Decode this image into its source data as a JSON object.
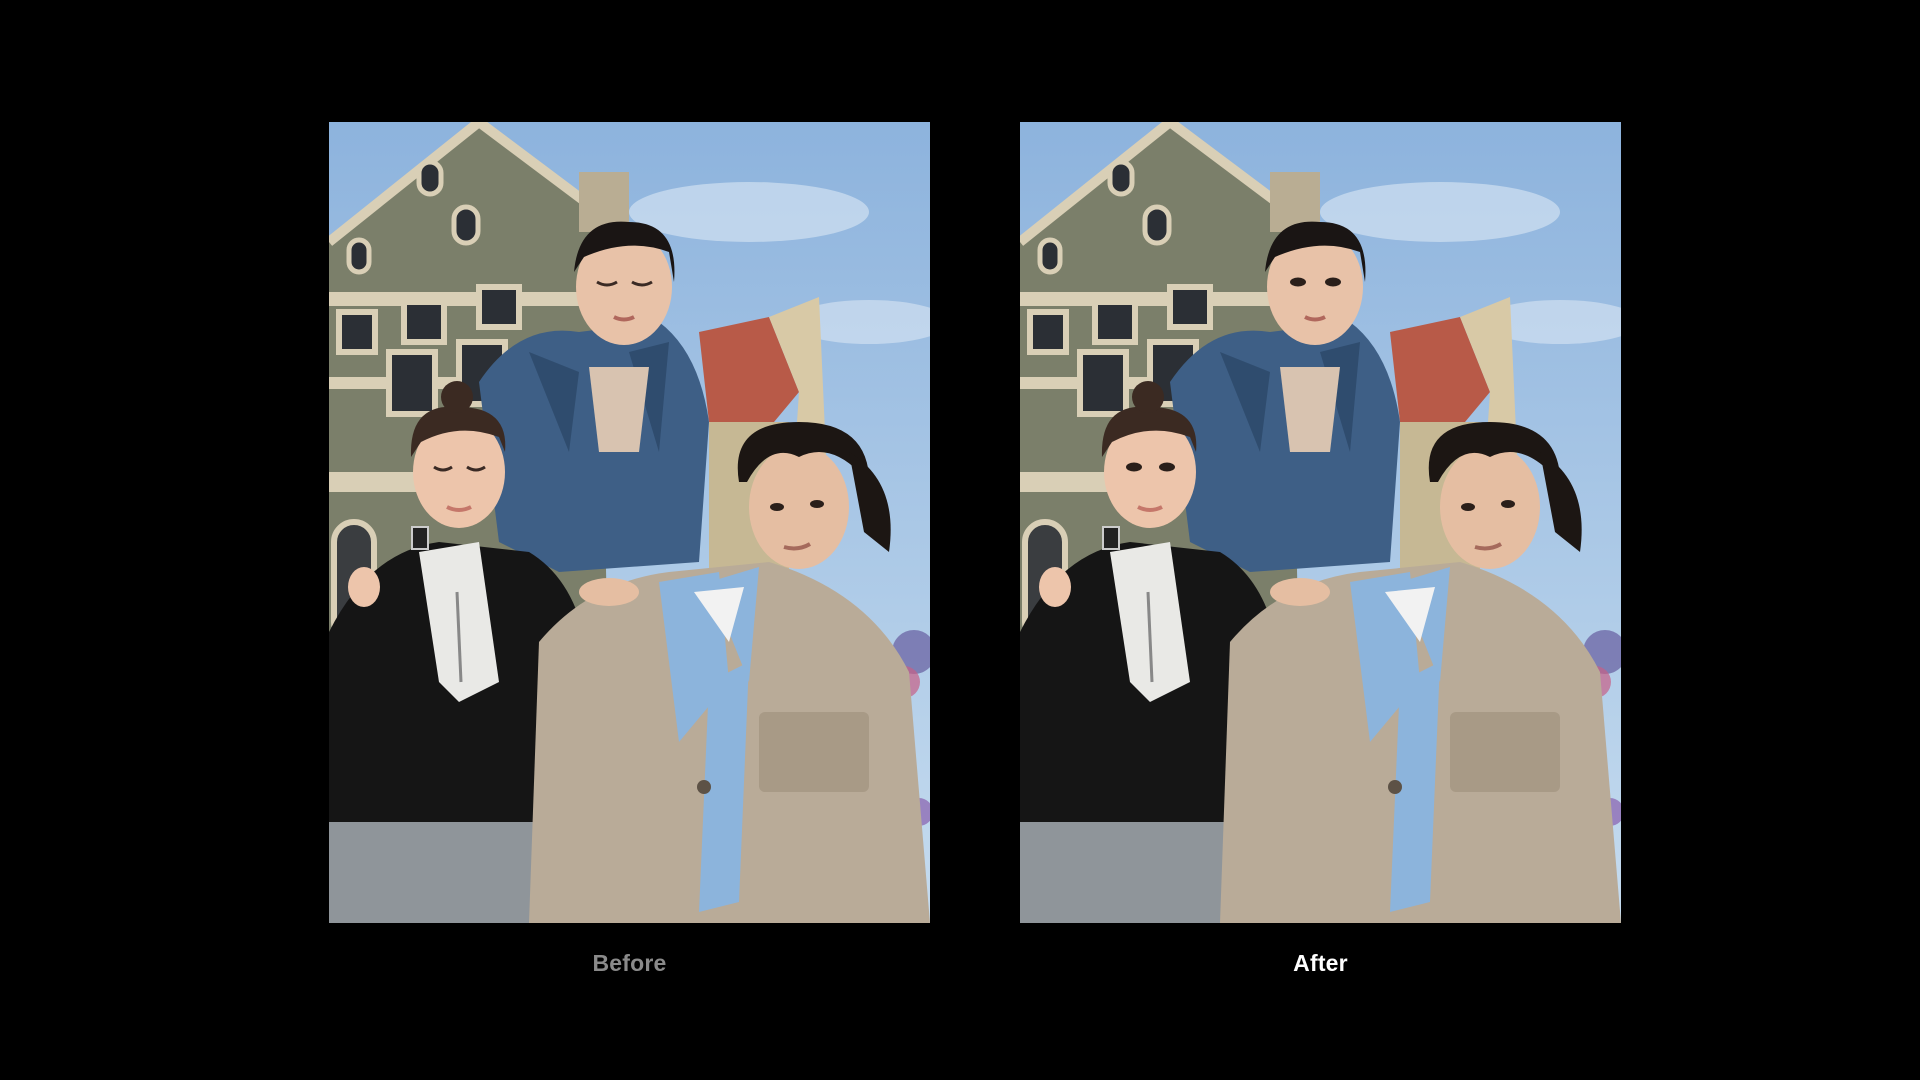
{
  "comparison": {
    "before": {
      "label": "Before",
      "label_color": "#8a8a8a",
      "eyes": "closed"
    },
    "after": {
      "label": "After",
      "label_color": "#ffffff",
      "eyes": "open"
    }
  },
  "colors": {
    "background": "#000000",
    "sky": "#8fb6df",
    "building_wall": "#7b7f6a",
    "trim": "#d9cfb6",
    "roof": "#b85a48",
    "denim": "#3e5f86",
    "black_jacket": "#151515",
    "beige_jacket": "#b9ab98",
    "light_blue_shirt": "#8cb4dc"
  }
}
